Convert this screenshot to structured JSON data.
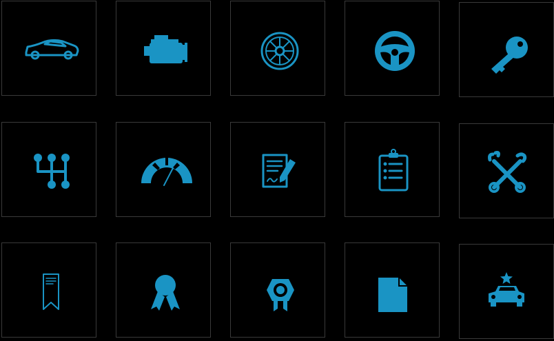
{
  "icon_color": "#1a94c4",
  "background": "#000000",
  "tile_border": "#3a3a3a",
  "icons": [
    [
      "sports-car-icon",
      "engine-icon",
      "wheel-rim-icon",
      "steering-wheel-icon",
      "key-icon"
    ],
    [
      "gear-shift-icon",
      "speedometer-icon",
      "contract-sign-icon",
      "clipboard-checklist-icon",
      "wrench-crossed-icon"
    ],
    [
      "bookmark-icon",
      "award-ribbon-icon",
      "certificate-seal-icon",
      "document-icon",
      "police-car-icon"
    ]
  ]
}
